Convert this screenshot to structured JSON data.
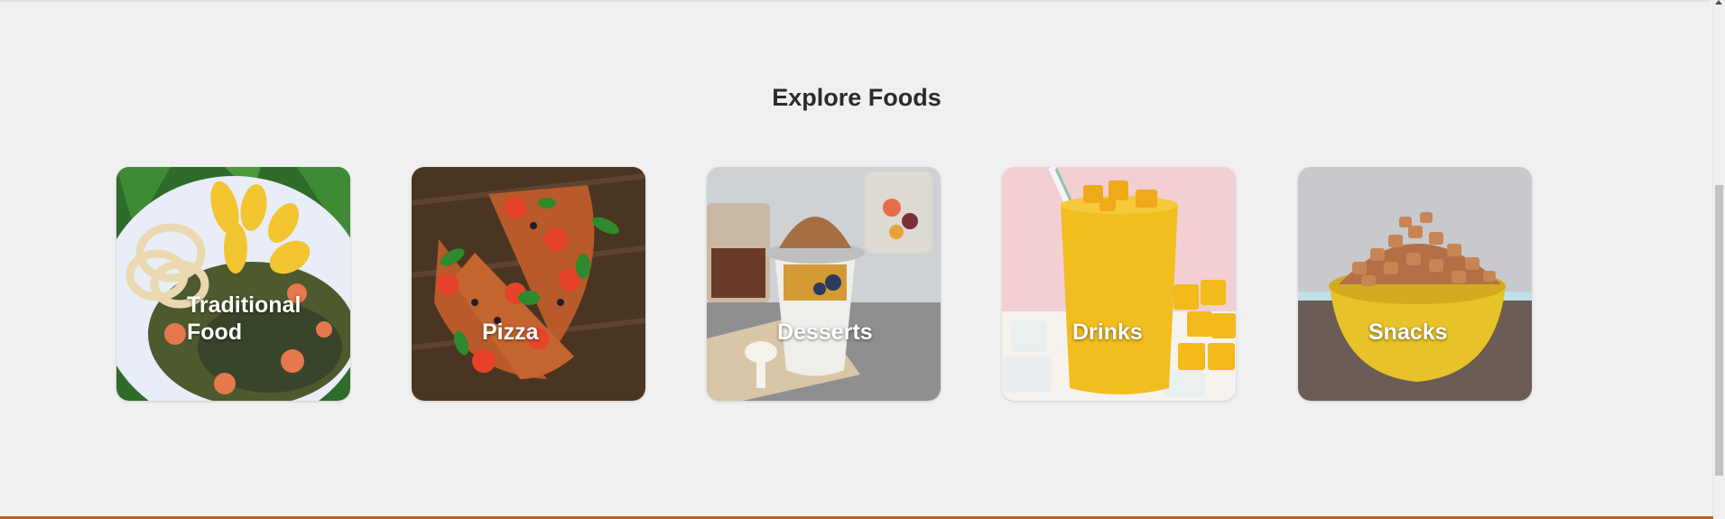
{
  "section": {
    "title": "Explore Foods"
  },
  "categories": [
    {
      "label": "Traditional Food",
      "image": "traditional-food-photo"
    },
    {
      "label": "Pizza",
      "image": "pizza-photo"
    },
    {
      "label": "Desserts",
      "image": "desserts-photo"
    },
    {
      "label": "Drinks",
      "image": "drinks-photo"
    },
    {
      "label": "Snacks",
      "image": "snacks-photo"
    }
  ],
  "colors": {
    "background": "#f0f0f0",
    "title": "#2b2b2b",
    "label": "#ffffff",
    "accent_bottom_bar": "#c2601d"
  }
}
